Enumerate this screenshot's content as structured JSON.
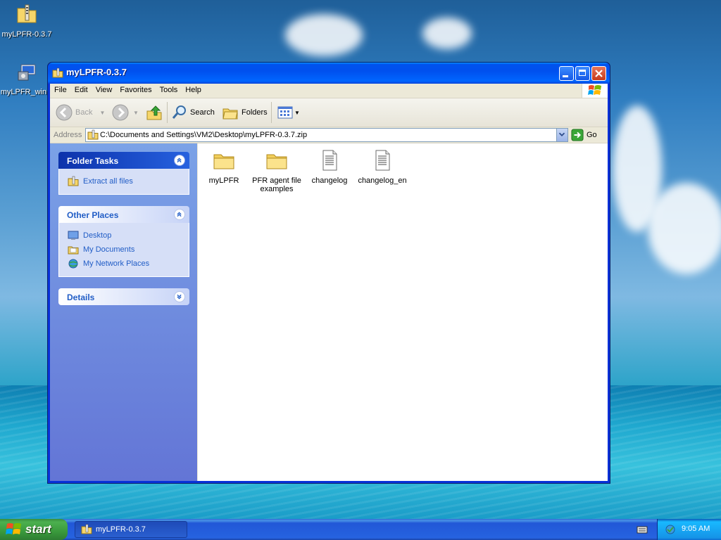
{
  "desktop": {
    "icons": [
      {
        "label": "myLPFR-0.3.7",
        "icon": "zip-folder-icon"
      },
      {
        "label": "myLPFR_win...",
        "icon": "installer-icon"
      }
    ]
  },
  "window": {
    "title": "myLPFR-0.3.7",
    "menu": [
      "File",
      "Edit",
      "View",
      "Favorites",
      "Tools",
      "Help"
    ],
    "toolbar": {
      "back": "Back",
      "search": "Search",
      "folders": "Folders"
    },
    "address": {
      "label": "Address",
      "value": "C:\\Documents and Settings\\VM2\\Desktop\\myLPFR-0.3.7.zip",
      "go": "Go"
    },
    "tasks": {
      "folder_tasks": {
        "title": "Folder Tasks",
        "items": [
          "Extract all files"
        ]
      },
      "other_places": {
        "title": "Other Places",
        "items": [
          "Desktop",
          "My Documents",
          "My Network Places"
        ]
      },
      "details": {
        "title": "Details"
      }
    },
    "files": [
      {
        "name": "myLPFR",
        "type": "folder"
      },
      {
        "name": "PFR agent file examples",
        "type": "folder"
      },
      {
        "name": "changelog",
        "type": "text-file"
      },
      {
        "name": "changelog_en",
        "type": "text-file"
      }
    ]
  },
  "taskbar": {
    "start": "start",
    "task": "myLPFR-0.3.7",
    "clock": "9:05 AM"
  },
  "colors": {
    "titlebar": "#0053ee",
    "task_link": "#215dc6",
    "task_pane": "#7ba2e7"
  }
}
